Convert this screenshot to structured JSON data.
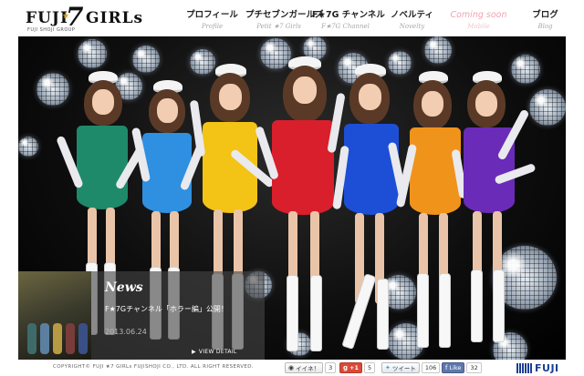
{
  "brand": {
    "logo_left": "FUJI",
    "logo_seven": "7",
    "logo_right": "GIRLs",
    "logo_tagline": "FUJI SHOJI GROUP"
  },
  "nav": {
    "items": [
      {
        "label": "プロフィール",
        "sub": "Profile"
      },
      {
        "label": "プチセブンガールズ",
        "sub": "Petit ★7 Girls"
      },
      {
        "label": "F★7G チャンネル",
        "sub": "F★7G Channel"
      },
      {
        "label": "ノベルティ",
        "sub": "Novelty"
      },
      {
        "label": "Coming soon",
        "sub": "Mobile"
      },
      {
        "label": "ブログ",
        "sub": "Blog"
      }
    ]
  },
  "news": {
    "title": "News",
    "headline": "F★7Gチャンネル「ホラー編」公開！",
    "date": "2013.06.24",
    "view_detail": "VIEW DETAIL"
  },
  "footer": {
    "copyright": "COPYRIGHT© FUJI ★7 GIRLs FUJISHOJI CO., LTD. ALL RIGHT RESERVED.",
    "mixi_label": "イイネ！",
    "mixi_count": "3",
    "gplus_label": "+1",
    "gplus_count": "5",
    "tweet_label": "ツイート",
    "tweet_count": "106",
    "like_label": "Like",
    "like_count": "32",
    "company_logo": "FUJI"
  },
  "colors": {
    "dress_teal": "#1e8a6a",
    "dress_sky": "#2f8fe0",
    "dress_yellow": "#f3c316",
    "dress_red": "#d81f2b",
    "dress_blue": "#1d4fd6",
    "dress_orange": "#f0931a",
    "dress_purple": "#6a2bb8",
    "nav_disabled": "#f2a3b2",
    "facebook": "#5f78ab",
    "google_plus": "#d84a38",
    "company_blue": "#1c3f94"
  },
  "icons": [
    "sparkle-icon",
    "mixi-icon",
    "google-plus-icon",
    "twitter-bird-icon",
    "facebook-icon",
    "play-triangle-icon"
  ]
}
